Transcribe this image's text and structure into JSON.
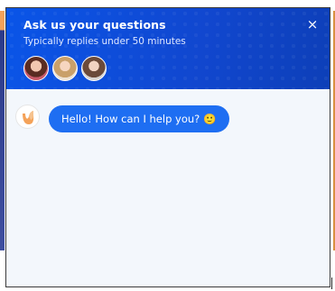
{
  "chat_widget": {
    "title": "Ask us your questions",
    "subtitle": "Typically replies under 50 minutes",
    "close_label": "×",
    "agents": [
      {
        "name_icon": "agent-avatar-1"
      },
      {
        "name_icon": "agent-avatar-2"
      },
      {
        "name_icon": "agent-avatar-3"
      }
    ],
    "messages": [
      {
        "from": "bot",
        "text": "Hello! How can I help you?",
        "emoji": "🙂"
      }
    ]
  },
  "colors": {
    "header_blue": "#0a55e8",
    "bubble_blue": "#1e6ef2",
    "body_background": "#f3f7fc",
    "bot_logo_orange": "#f4a259"
  }
}
